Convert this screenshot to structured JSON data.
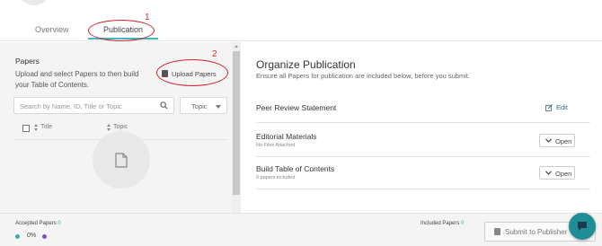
{
  "tabs": [
    {
      "label": "Overview"
    },
    {
      "label": "Publication"
    }
  ],
  "annotations": [
    "1",
    "2"
  ],
  "papers_panel": {
    "title": "Papers",
    "description": "Upload and select Papers to then build your Table of Contents.",
    "upload_button": "Upload Papers",
    "search_placeholder": "Search by Name, ID, Title or Topic",
    "topic_filter": "Topic",
    "columns": [
      "Title",
      "Topic"
    ]
  },
  "organize": {
    "title": "Organize Publication",
    "subtitle": "Ensure all Papers for publication are included below, before you submit.",
    "sections": [
      {
        "title": "Peer Review Statement",
        "action": "Edit"
      },
      {
        "title": "Editorial Materials",
        "subtitle": "No Files Attached",
        "action": "Open"
      },
      {
        "title": "Build Table of Contents",
        "subtitle": "0 papers included",
        "action": "Open"
      }
    ]
  },
  "footer": {
    "accepted_label": "Accepted Papers",
    "accepted_count": "0",
    "percent": "0%",
    "included_label": "Included Papers",
    "included_count": "0",
    "submit_button": "Submit to Publisher"
  },
  "colors": {
    "accent": "#3db7c4",
    "annotation": "#d2232a",
    "chat": "#1f8d96",
    "purple": "#7a4fc0"
  },
  "icons": [
    "search-icon",
    "document-icon",
    "pencil-icon",
    "chevron-down-icon",
    "chat-icon",
    "sort-icon"
  ]
}
